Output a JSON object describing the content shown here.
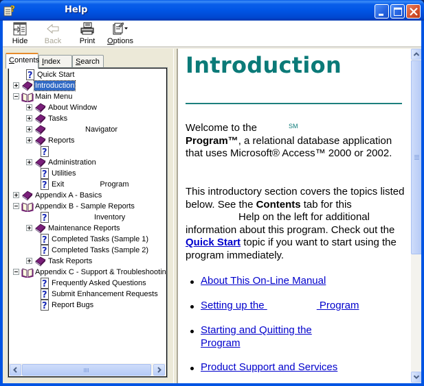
{
  "window": {
    "title": "Help",
    "controls": {
      "minimize": "minimize",
      "maximize": "maximize",
      "close": "close"
    }
  },
  "toolbar": {
    "buttons": [
      {
        "label": "Hide",
        "icon": "hide-pane-icon",
        "enabled": true
      },
      {
        "label": "Back",
        "icon": "back-arrow-icon",
        "enabled": false
      },
      {
        "label": "Print",
        "icon": "printer-icon",
        "enabled": true
      },
      {
        "label": "Options",
        "icon": "options-icon",
        "enabled": true
      }
    ]
  },
  "tabs": [
    {
      "label": "Contents",
      "accel": "C",
      "active": true
    },
    {
      "label": "Index",
      "accel": "I",
      "active": false
    },
    {
      "label": "Search",
      "accel": "S",
      "active": false
    }
  ],
  "tree": [
    {
      "label": "Quick Start",
      "type": "page",
      "level": 1,
      "expander": "none"
    },
    {
      "label": "Introduction",
      "type": "book-closed",
      "level": 0,
      "expander": "plus",
      "selected": true
    },
    {
      "label": "Main Menu",
      "type": "book-open",
      "level": 0,
      "expander": "minus"
    },
    {
      "label": "About Window",
      "type": "book-closed",
      "level": 1,
      "expander": "plus"
    },
    {
      "label": "Tasks",
      "type": "book-closed",
      "level": 1,
      "expander": "plus"
    },
    {
      "label": "Navigator",
      "type": "book-closed",
      "level": 1,
      "expander": "plus",
      "redacted_prefix": true
    },
    {
      "label": "Reports",
      "type": "book-closed",
      "level": 1,
      "expander": "plus"
    },
    {
      "label": "",
      "type": "page",
      "level": 2,
      "expander": "none"
    },
    {
      "label": "Administration",
      "type": "book-closed",
      "level": 1,
      "expander": "plus"
    },
    {
      "label": "Utilities",
      "type": "page",
      "level": 2,
      "expander": "none"
    },
    {
      "label_a": "Exit",
      "label_b": "Program",
      "type": "page",
      "level": 2,
      "expander": "none",
      "split": true
    },
    {
      "label": "Appendix A - Basics",
      "type": "book-closed",
      "level": 0,
      "expander": "plus"
    },
    {
      "label": "Appendix B - Sample Reports",
      "type": "book-open",
      "level": 0,
      "expander": "minus"
    },
    {
      "label": "Inventory",
      "type": "page",
      "level": 2,
      "expander": "none",
      "redacted_prefix": true
    },
    {
      "label": "Maintenance Reports",
      "type": "book-closed",
      "level": 1,
      "expander": "plus"
    },
    {
      "label": "Completed Tasks (Sample 1)",
      "type": "page",
      "level": 2,
      "expander": "none"
    },
    {
      "label": "Completed Tasks (Sample 2)",
      "type": "page",
      "level": 2,
      "expander": "none"
    },
    {
      "label": "Task Reports",
      "type": "book-closed",
      "level": 1,
      "expander": "plus"
    },
    {
      "label": "Appendix C - Support & Troubleshooting",
      "type": "book-open",
      "level": 0,
      "expander": "minus"
    },
    {
      "label": "Frequently Asked Questions",
      "type": "page",
      "level": 2,
      "expander": "none"
    },
    {
      "label": "Submit Enhancement Requests",
      "type": "page",
      "level": 2,
      "expander": "none"
    },
    {
      "label": "Report Bugs",
      "type": "page",
      "level": 2,
      "expander": "none"
    }
  ],
  "content": {
    "heading": "Introduction",
    "p1": {
      "welcome": "Welcome to the",
      "sm": "SM",
      "program_bold": "Program™",
      "rest": ", a relational database application that uses Microsoft® Access™ 2000 or 2002."
    },
    "p2": {
      "a": "This introductory section covers the topics listed below. See the ",
      "contents_bold": "Contents",
      "b": " tab for this",
      "c": "Help on the left for additional information about this program. Check out the ",
      "quick_start_link": "Quick Start",
      "d": " topic if you want to start using the program immediately."
    },
    "topics": [
      {
        "label": "About This On-Line Manual"
      },
      {
        "label_a": "Setting up the ",
        "label_b": " Program"
      },
      {
        "label_a": "Starting and Quitting the ",
        "label_b": "Program"
      },
      {
        "label": "Product Support and Services"
      }
    ]
  },
  "scrollbars": {
    "vertical_position": 0.0,
    "vertical_visible_fraction": 0.62,
    "horizontal_position": 0.0
  }
}
